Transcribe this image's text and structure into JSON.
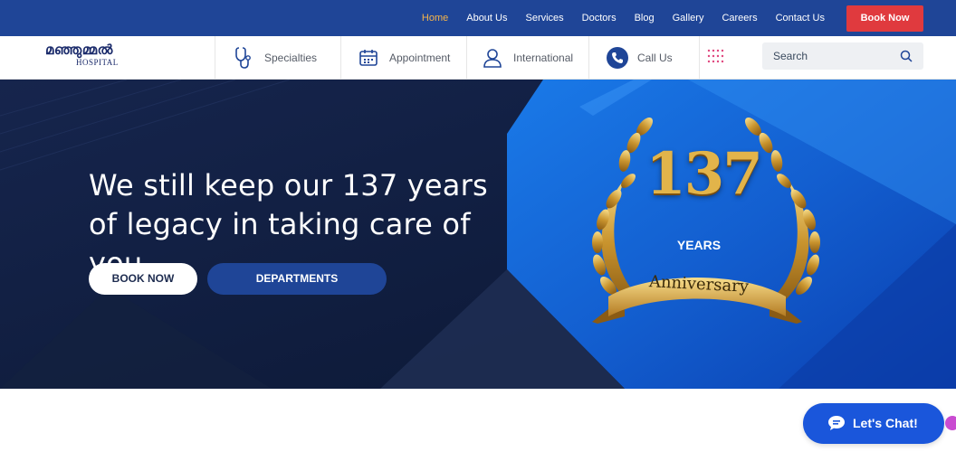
{
  "topnav": {
    "items": [
      {
        "label": "Home",
        "active": true
      },
      {
        "label": "About Us"
      },
      {
        "label": "Services"
      },
      {
        "label": "Doctors"
      },
      {
        "label": "Blog"
      },
      {
        "label": "Gallery"
      },
      {
        "label": "Careers"
      },
      {
        "label": "Contact Us"
      }
    ],
    "book_label": "Book Now"
  },
  "logo": {
    "script_text": "മഞ്ഞുമ്മൽ",
    "sub_text": "HOSPITAL"
  },
  "menu": {
    "specialties": "Specialties",
    "appointment": "Appointment",
    "international": "International",
    "call": "Call Us"
  },
  "search": {
    "placeholder": "Search"
  },
  "hero": {
    "headline": "We still keep our 137 years of legacy in taking care of you",
    "book_label": "BOOK NOW",
    "departments_label": "DEPARTMENTS",
    "badge": {
      "number": "137",
      "years": "YEARS",
      "ribbon": "Anniversary"
    }
  },
  "chat": {
    "label": "Let's Chat!"
  },
  "colors": {
    "topbar": "#1f4597",
    "active": "#f7b54a",
    "book": "#e03a3e",
    "hero_dark": "#0d1a3a",
    "hero_blue": "#1564d8",
    "gold": "#d9a93a",
    "chat": "#1a56db"
  },
  "icons": [
    "stethoscope-icon",
    "calendar-icon",
    "user-icon",
    "phone-icon",
    "grid-icon",
    "search-icon",
    "chat-icon"
  ]
}
